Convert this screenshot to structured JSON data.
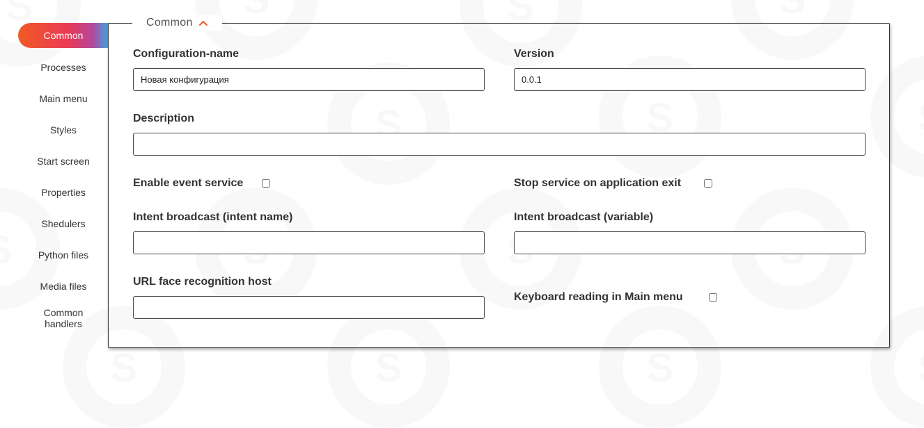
{
  "sidebar": {
    "items": [
      {
        "label": "Common",
        "active": true
      },
      {
        "label": "Processes"
      },
      {
        "label": "Main menu"
      },
      {
        "label": "Styles"
      },
      {
        "label": "Start screen"
      },
      {
        "label": "Properties"
      },
      {
        "label": "Shedulers"
      },
      {
        "label": "Python files"
      },
      {
        "label": "Media files"
      },
      {
        "label": "Common handlers"
      }
    ]
  },
  "section": {
    "title": "Common",
    "chevron_icon": "chevron-up-icon",
    "accent_color": "#f15a24"
  },
  "form": {
    "configuration_name": {
      "label": "Configuration-name",
      "value": "Новая конфигурация"
    },
    "version": {
      "label": "Version",
      "value": "0.0.1"
    },
    "description": {
      "label": "Description",
      "value": ""
    },
    "enable_event_service": {
      "label": "Enable event service",
      "checked": false
    },
    "stop_service_on_exit": {
      "label": "Stop service on application exit",
      "checked": false
    },
    "intent_broadcast_name": {
      "label": "Intent broadcast (intent name)",
      "value": ""
    },
    "intent_broadcast_variable": {
      "label": "Intent broadcast (variable)",
      "value": ""
    },
    "url_face_recognition_host": {
      "label": "URL face recognition host",
      "value": ""
    },
    "keyboard_reading_main_menu": {
      "label": "Keyboard reading in Main menu",
      "checked": false
    }
  }
}
